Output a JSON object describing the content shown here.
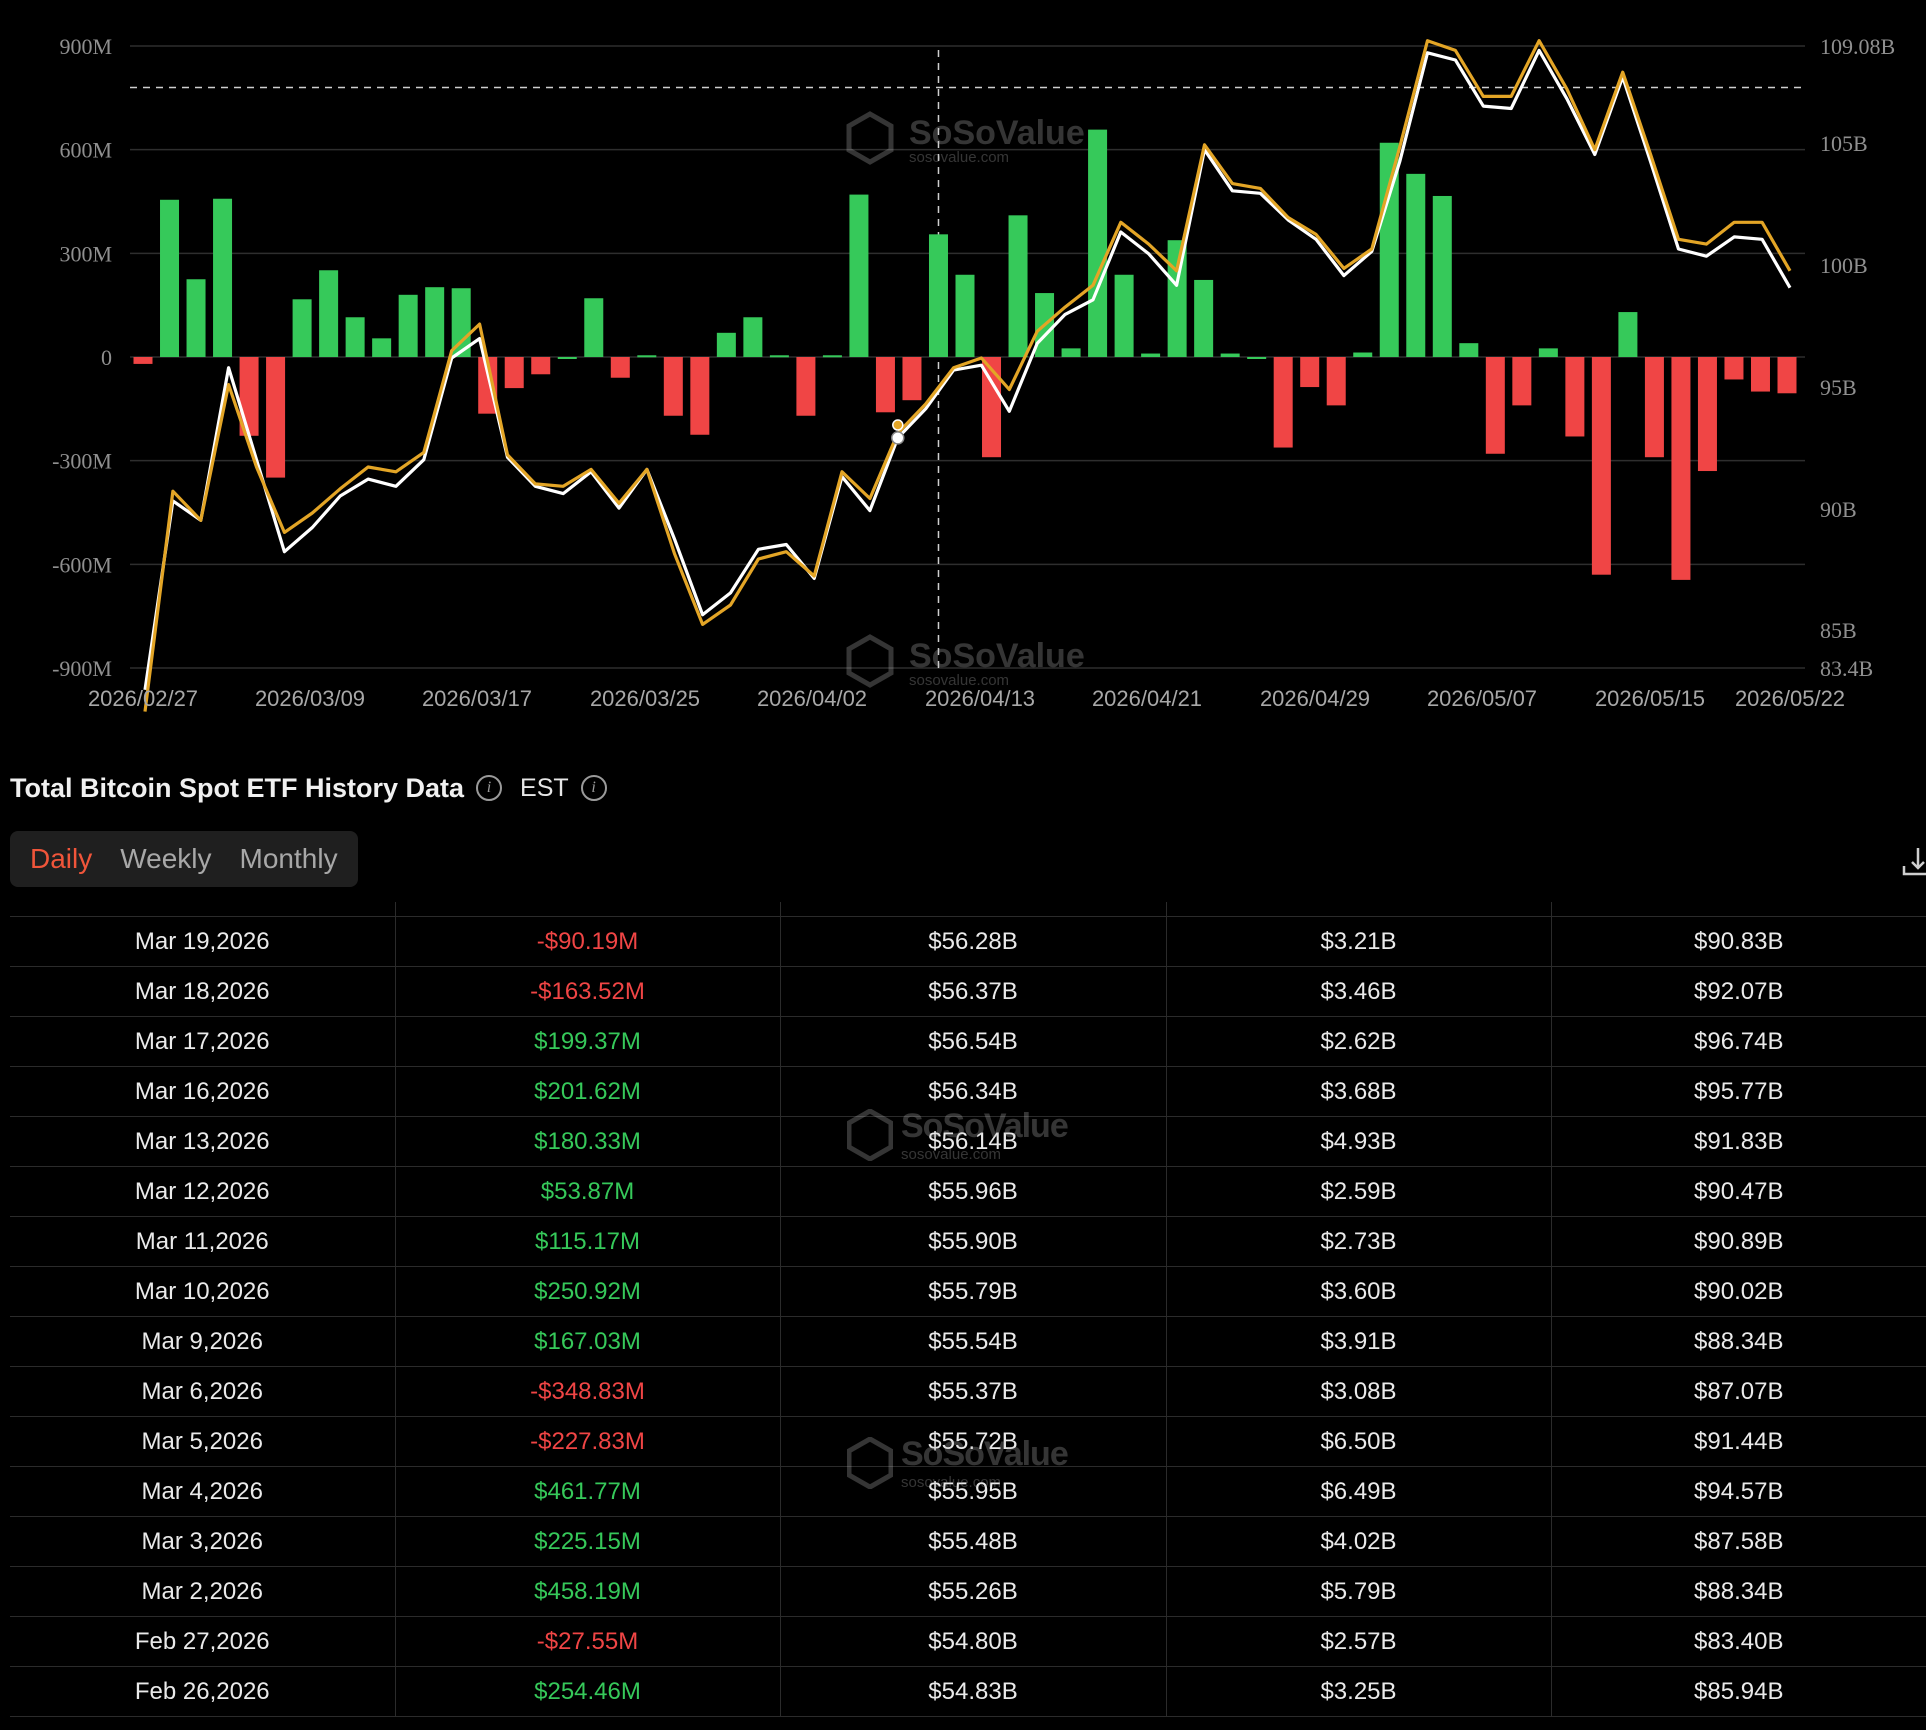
{
  "chart_data": {
    "type": "bar",
    "left_axis_ticks": [
      "900M",
      "600M",
      "300M",
      "0",
      "-300M",
      "-600M",
      "-900M"
    ],
    "right_axis_ticks": [
      "109.08B",
      "105B",
      "100B",
      "95B",
      "90B",
      "85B",
      "83.4B"
    ],
    "x_tick_labels": [
      "2026/02/27",
      "2026/03/09",
      "2026/03/17",
      "2026/03/25",
      "2026/04/02",
      "2026/04/13",
      "2026/04/21",
      "2026/04/29",
      "2026/05/07",
      "2026/05/15",
      "2026/05/22"
    ],
    "ylim_left": [
      -900,
      900
    ],
    "ylim_right": [
      83.4,
      109.08
    ],
    "reference_line_left": 780,
    "crosshair_index": 30,
    "series": [
      {
        "values": [
          -20,
          455,
          225,
          458,
          -228,
          -349,
          167,
          251,
          115,
          54,
          180,
          202,
          199,
          -164,
          -90,
          -50,
          0,
          170,
          -60,
          5,
          -170,
          -225,
          70,
          115,
          5,
          -170,
          5,
          470,
          -160,
          -125,
          355,
          238,
          -290,
          410,
          185,
          25,
          658,
          238,
          10,
          338,
          223,
          10,
          0,
          -262,
          -87,
          -140,
          13,
          620,
          530,
          466,
          40,
          -280,
          -140,
          25,
          -230,
          -630,
          130,
          -290,
          -645,
          -330,
          -65,
          -100,
          -105
        ]
      },
      {
        "values": [
          82.5,
          90.3,
          89.5,
          95.8,
          92.0,
          88.2,
          89.2,
          90.5,
          91.2,
          90.9,
          92.0,
          96.2,
          97.0,
          92.1,
          90.9,
          90.6,
          91.5,
          90.0,
          91.6,
          88.7,
          85.6,
          86.5,
          88.3,
          88.5,
          87.1,
          91.3,
          89.9,
          92.9,
          94.1,
          95.7,
          95.9,
          94.0,
          96.8,
          98.0,
          98.6,
          101.4,
          100.5,
          99.2,
          104.8,
          103.1,
          103.0,
          101.9,
          101.1,
          99.6,
          100.6,
          104.3,
          108.8,
          108.5,
          106.6,
          106.5,
          108.9,
          106.9,
          104.6,
          107.8,
          104.3,
          100.7,
          100.4,
          101.2,
          101.1,
          99.1
        ]
      },
      {
        "values": [
          81.6,
          90.7,
          89.5,
          95.1,
          91.7,
          89.0,
          89.8,
          90.8,
          91.7,
          91.5,
          92.3,
          96.5,
          97.6,
          92.2,
          91.0,
          90.9,
          91.6,
          90.2,
          91.6,
          88.1,
          85.2,
          86.0,
          87.9,
          88.2,
          87.2,
          91.5,
          90.4,
          93.1,
          94.3,
          95.8,
          96.2,
          94.9,
          97.3,
          98.3,
          99.2,
          101.8,
          100.9,
          99.8,
          105.0,
          103.4,
          103.2,
          102.0,
          101.3,
          99.9,
          100.7,
          104.9,
          109.3,
          108.9,
          107.0,
          107.0,
          109.3,
          107.3,
          104.8,
          108.0,
          104.6,
          101.1,
          100.9,
          101.8,
          101.8,
          99.8
        ]
      }
    ]
  },
  "watermark": {
    "brand": "SoSoValue",
    "domain": "sosovalue.com"
  },
  "section": {
    "title": "Total Bitcoin Spot ETF History Data",
    "timezone": "EST"
  },
  "tabs": {
    "daily": "Daily",
    "weekly": "Weekly",
    "monthly": "Monthly"
  },
  "colors": {
    "positive": "#36c95a",
    "negative": "#f04545",
    "accent": "#f0553a",
    "line_gold": "#e3a526",
    "line_white": "#ffffff"
  },
  "rows": [
    {
      "date": "Mar 19,2026",
      "flow": "-$90.19M",
      "c3": "$56.28B",
      "c4": "$3.21B",
      "c5": "$90.83B",
      "sign": "neg"
    },
    {
      "date": "Mar 18,2026",
      "flow": "-$163.52M",
      "c3": "$56.37B",
      "c4": "$3.46B",
      "c5": "$92.07B",
      "sign": "neg"
    },
    {
      "date": "Mar 17,2026",
      "flow": "$199.37M",
      "c3": "$56.54B",
      "c4": "$2.62B",
      "c5": "$96.74B",
      "sign": "pos"
    },
    {
      "date": "Mar 16,2026",
      "flow": "$201.62M",
      "c3": "$56.34B",
      "c4": "$3.68B",
      "c5": "$95.77B",
      "sign": "pos"
    },
    {
      "date": "Mar 13,2026",
      "flow": "$180.33M",
      "c3": "$56.14B",
      "c4": "$4.93B",
      "c5": "$91.83B",
      "sign": "pos"
    },
    {
      "date": "Mar 12,2026",
      "flow": "$53.87M",
      "c3": "$55.96B",
      "c4": "$2.59B",
      "c5": "$90.47B",
      "sign": "pos"
    },
    {
      "date": "Mar 11,2026",
      "flow": "$115.17M",
      "c3": "$55.90B",
      "c4": "$2.73B",
      "c5": "$90.89B",
      "sign": "pos"
    },
    {
      "date": "Mar 10,2026",
      "flow": "$250.92M",
      "c3": "$55.79B",
      "c4": "$3.60B",
      "c5": "$90.02B",
      "sign": "pos"
    },
    {
      "date": "Mar 9,2026",
      "flow": "$167.03M",
      "c3": "$55.54B",
      "c4": "$3.91B",
      "c5": "$88.34B",
      "sign": "pos"
    },
    {
      "date": "Mar 6,2026",
      "flow": "-$348.83M",
      "c3": "$55.37B",
      "c4": "$3.08B",
      "c5": "$87.07B",
      "sign": "neg"
    },
    {
      "date": "Mar 5,2026",
      "flow": "-$227.83M",
      "c3": "$55.72B",
      "c4": "$6.50B",
      "c5": "$91.44B",
      "sign": "neg"
    },
    {
      "date": "Mar 4,2026",
      "flow": "$461.77M",
      "c3": "$55.95B",
      "c4": "$6.49B",
      "c5": "$94.57B",
      "sign": "pos"
    },
    {
      "date": "Mar 3,2026",
      "flow": "$225.15M",
      "c3": "$55.48B",
      "c4": "$4.02B",
      "c5": "$87.58B",
      "sign": "pos"
    },
    {
      "date": "Mar 2,2026",
      "flow": "$458.19M",
      "c3": "$55.26B",
      "c4": "$5.79B",
      "c5": "$88.34B",
      "sign": "pos"
    },
    {
      "date": "Feb 27,2026",
      "flow": "-$27.55M",
      "c3": "$54.80B",
      "c4": "$2.57B",
      "c5": "$83.40B",
      "sign": "neg"
    },
    {
      "date": "Feb 26,2026",
      "flow": "$254.46M",
      "c3": "$54.83B",
      "c4": "$3.25B",
      "c5": "$85.94B",
      "sign": "pos"
    }
  ]
}
